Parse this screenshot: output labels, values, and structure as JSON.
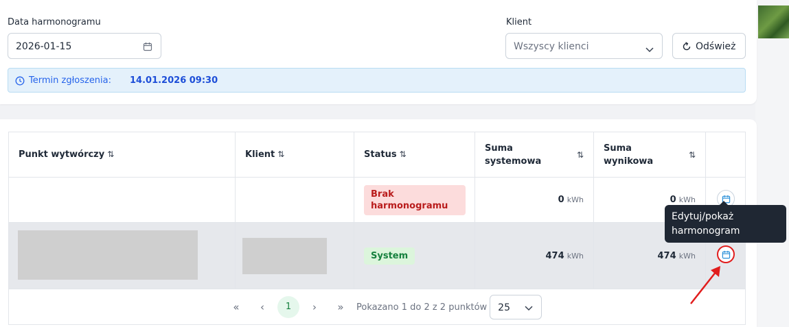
{
  "filters": {
    "date_label": "Data harmonogramu",
    "date_value": "2026-01-15",
    "client_label": "Klient",
    "client_value": "Wszyscy klienci",
    "refresh_label": "Odśwież"
  },
  "info": {
    "prefix": "Termin zgłoszenia:",
    "deadline": "14.01.2026 09:30"
  },
  "table": {
    "columns": [
      "Punkt wytwórczy",
      "Klient",
      "Status",
      "Suma systemowa",
      "Suma wynikowa"
    ],
    "sort_icon": "⇅",
    "rows": [
      {
        "punkt": "",
        "klient": "",
        "status": "Brak harmonogramu",
        "status_color": "#b91c1c",
        "suma_systemowa": "0",
        "suma_wynikowa": "0",
        "unit": "kWh"
      },
      {
        "punkt": "",
        "klient": "",
        "status": "System",
        "status_color": "#15803d",
        "suma_systemowa": "474",
        "suma_wynikowa": "474",
        "unit": "kWh"
      }
    ]
  },
  "pagination": {
    "first": "«",
    "prev": "‹",
    "current": "1",
    "next": "›",
    "last": "»",
    "info": "Pokazano 1 do 2 z 2 punktów",
    "page_size": "25"
  },
  "tooltip": {
    "line1": "Edytuj/pokaż",
    "line2": "harmonogram"
  },
  "colors": {
    "accent": "#2563eb",
    "highlight": "#e11d1d"
  }
}
